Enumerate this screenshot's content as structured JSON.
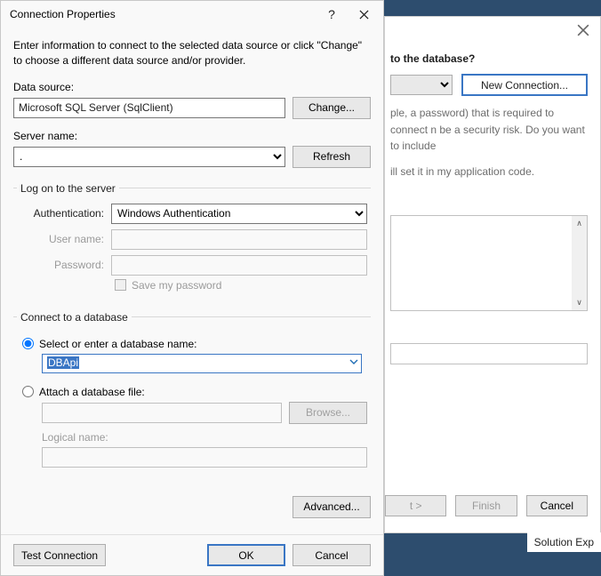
{
  "dialog": {
    "title": "Connection Properties",
    "intro": "Enter information to connect to the selected data source or click \"Change\" to choose a different data source and/or provider.",
    "data_source_label": "Data source:",
    "data_source_value": "Microsoft SQL Server (SqlClient)",
    "change_btn": "Change...",
    "server_name_label": "Server name:",
    "server_name_value": ".",
    "refresh_btn": "Refresh",
    "logon_legend": "Log on to the server",
    "auth_label": "Authentication:",
    "auth_value": "Windows Authentication",
    "username_label": "User name:",
    "username_value": "",
    "password_label": "Password:",
    "password_value": "",
    "save_pw_label": "Save my password",
    "connect_legend": "Connect to a database",
    "radio_select_label": "Select or enter a database name:",
    "db_name_value": "DBApi",
    "radio_attach_label": "Attach a database file:",
    "browse_btn": "Browse...",
    "logical_label": "Logical name:",
    "logical_value": "",
    "advanced_btn": "Advanced...",
    "test_btn": "Test Connection",
    "ok_btn": "OK",
    "cancel_btn": "Cancel"
  },
  "bg": {
    "heading": "to the database?",
    "new_conn_btn": "New Connection...",
    "para1": "ple, a password) that is required to connect n be a security risk. Do you want to include",
    "radio_text": "ill set it in my application code.",
    "next_btn": "t >",
    "finish_btn": "Finish",
    "cancel_btn": "Cancel",
    "solution_tab": "Solution Exp"
  }
}
